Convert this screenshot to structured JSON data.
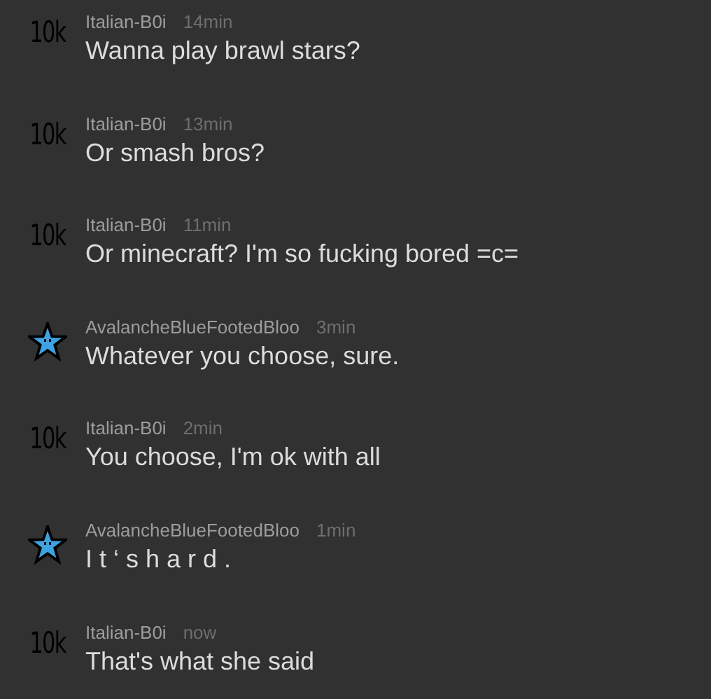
{
  "messages": [
    {
      "avatar": {
        "kind": "text",
        "text": "10k"
      },
      "author": "Italian-B0i",
      "time": "14min",
      "text": "Wanna play brawl stars?"
    },
    {
      "avatar": {
        "kind": "text",
        "text": "10k"
      },
      "author": "Italian-B0i",
      "time": "13min",
      "text": "Or smash bros?"
    },
    {
      "avatar": {
        "kind": "text",
        "text": "10k"
      },
      "author": "Italian-B0i",
      "time": "11min",
      "text": "Or minecraft? I'm so fucking bored =c="
    },
    {
      "avatar": {
        "kind": "star"
      },
      "author": "AvalancheBlueFootedBloo",
      "time": "3min",
      "text": "Whatever you choose, sure."
    },
    {
      "avatar": {
        "kind": "text",
        "text": "10k"
      },
      "author": "Italian-B0i",
      "time": "2min",
      "text": "You choose, I'm ok with all"
    },
    {
      "avatar": {
        "kind": "star"
      },
      "author": "AvalancheBlueFootedBloo",
      "time": "1min",
      "text": "I t ‘ s h a r d ."
    },
    {
      "avatar": {
        "kind": "text",
        "text": "10k"
      },
      "author": "Italian-B0i",
      "time": "now",
      "text": "That's what she said"
    }
  ]
}
